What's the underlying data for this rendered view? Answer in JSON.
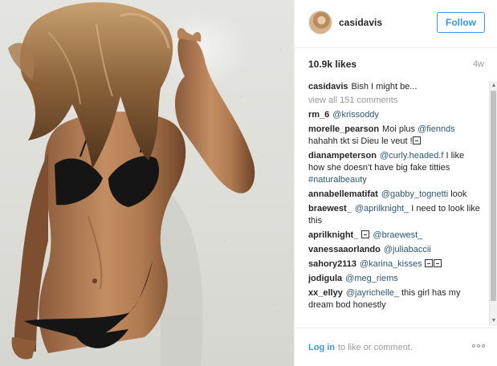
{
  "post": {
    "username": "casidavis",
    "follow_label": "Follow",
    "likes": "10.9k likes",
    "age": "4w",
    "caption_user": "casidavis",
    "caption_text": "Bish I might be...",
    "view_all": "view all 151 comments"
  },
  "comments": [
    {
      "user": "rm_6",
      "parts": [
        {
          "m": "@krissoddy"
        }
      ]
    },
    {
      "user": "morelle_pearson",
      "parts": [
        {
          "t": "Moi plus "
        },
        {
          "m": "@fiennds"
        },
        {
          "t": " hahahh tkt si Dieu le veut !"
        },
        {
          "g": "emoji"
        }
      ]
    },
    {
      "user": "dianampeterson",
      "parts": [
        {
          "m": "@curly.headed.f"
        },
        {
          "t": " I like how she doesn't have big fake titties "
        },
        {
          "m": "#naturalbeauty"
        }
      ]
    },
    {
      "user": "annabellematifat",
      "parts": [
        {
          "m": "@gabby_tognetti"
        },
        {
          "t": " look"
        }
      ]
    },
    {
      "user": "braewest_",
      "parts": [
        {
          "m": "@aprilknight_"
        },
        {
          "t": " I need to look like this"
        }
      ]
    },
    {
      "user": "aprilknight_",
      "parts": [
        {
          "g": "emoji"
        },
        {
          "t": " "
        },
        {
          "m": "@braewest_"
        }
      ]
    },
    {
      "user": "vanessaaorlando",
      "parts": [
        {
          "m": "@juliabaccii"
        }
      ]
    },
    {
      "user": "sahory2113",
      "parts": [
        {
          "m": "@karina_kisses"
        },
        {
          "t": " "
        },
        {
          "g": "emoji"
        },
        {
          "g": "emoji"
        }
      ]
    },
    {
      "user": "jodigula",
      "parts": [
        {
          "m": "@meg_riems"
        }
      ]
    },
    {
      "user": "xx_ellyy",
      "parts": [
        {
          "m": "@jayrichelle_"
        },
        {
          "t": " this girl has my dream bod honestly"
        }
      ]
    }
  ],
  "footer": {
    "login_link": "Log in",
    "login_text": "to like or comment."
  },
  "icons": {
    "more": "more-options-icon",
    "scroll_up": "scroll-up-arrow-icon",
    "scroll_down": "scroll-down-arrow-icon"
  },
  "colors": {
    "accent": "#3897f0",
    "mention": "#2b5876",
    "muted": "#999999"
  }
}
